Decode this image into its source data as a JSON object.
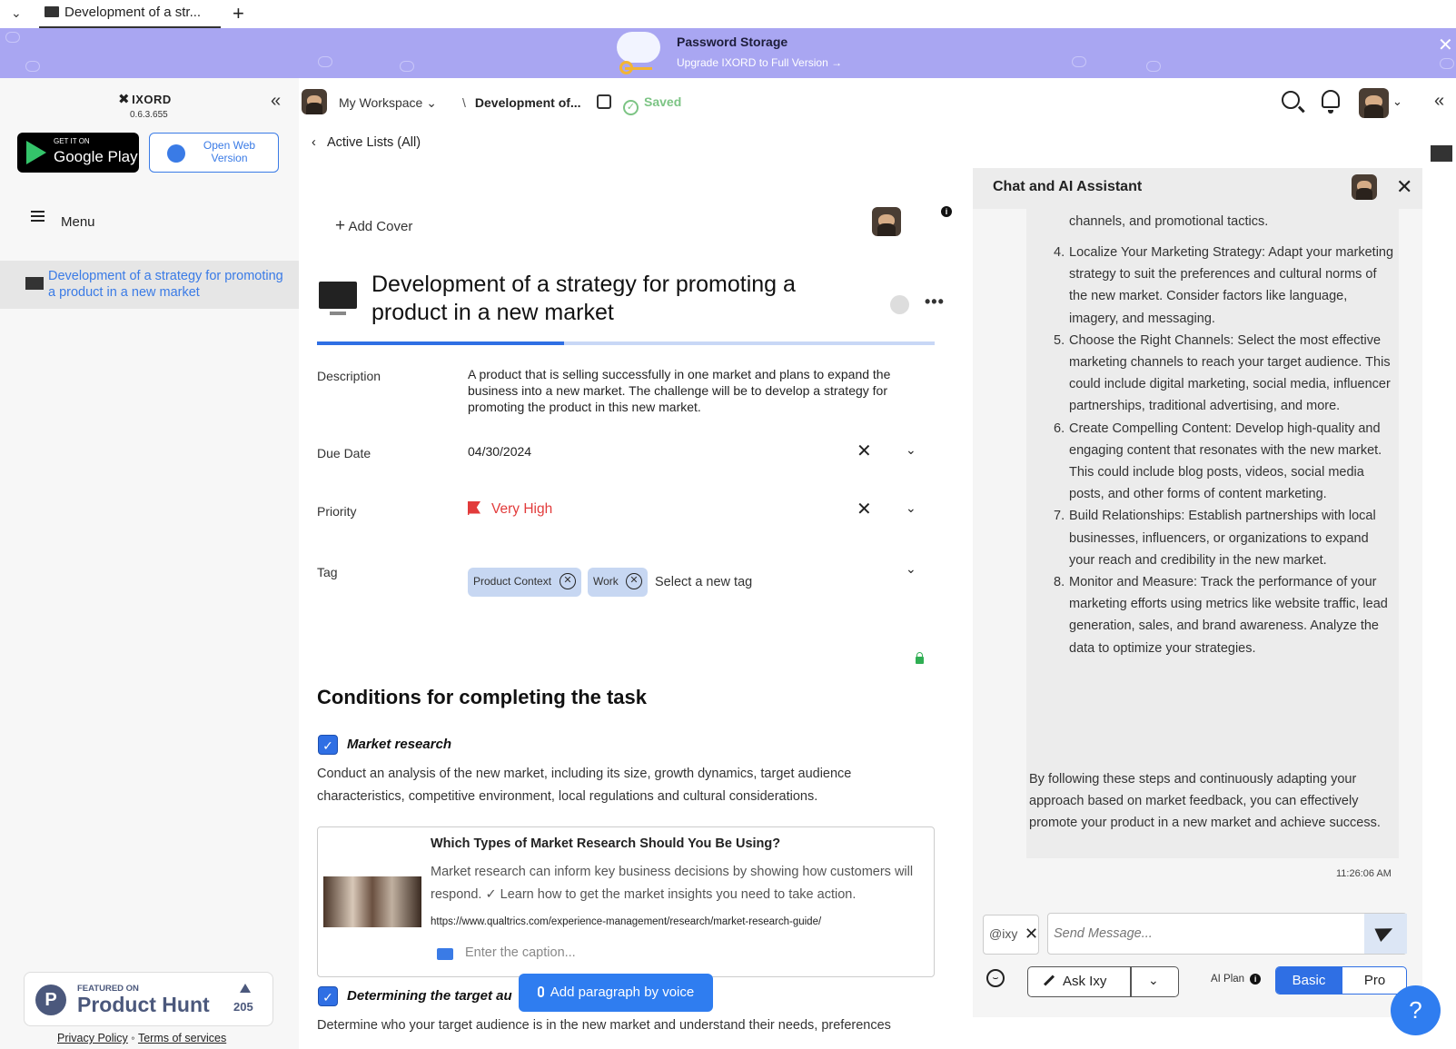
{
  "tabbar": {
    "tab_title": "Development of a str...",
    "new_tab": "+"
  },
  "banner": {
    "title": "Password Storage",
    "subtitle": "Upgrade IXORD to Full Version →",
    "close": "✕"
  },
  "sidebar": {
    "brand": "IXORD",
    "version": "0.6.3.655",
    "collapse": "«",
    "google_play_small": "GET IT ON",
    "google_play_big": "Google Play",
    "open_web_line1": "Open Web",
    "open_web_line2": "Version",
    "menu_label": "Menu",
    "active_item": "Development of a strategy for promoting a product in a new market",
    "product_hunt": {
      "featured": "FEATURED ON",
      "name": "Product Hunt",
      "count": "205"
    },
    "privacy": "Privacy Policy",
    "terms": "Terms of services"
  },
  "header": {
    "workspace": "My Workspace",
    "breadcrumb": "Development of...",
    "saved": "Saved",
    "back": "Active Lists (All)"
  },
  "task": {
    "add_cover": "Add Cover",
    "title": "Development of a strategy for promoting a product in a new market",
    "progress_fraction": 0.4,
    "fields": {
      "description_label": "Description",
      "description": "A product that is selling successfully in one market and plans to expand the business into a new market. The challenge will be to develop a strategy for promoting the product in this new market.",
      "due_label": "Due Date",
      "due_value": "04/30/2024",
      "priority_label": "Priority",
      "priority_value": "Very High",
      "tag_label": "Tag",
      "tags": [
        "Product Context",
        "Work"
      ],
      "tag_placeholder": "Select a new tag"
    },
    "conditions_heading": "Conditions for completing the task",
    "condition1_title": "Market research",
    "condition1_text": "Conduct an analysis of the new market, including its size, growth dynamics, target audience characteristics, competitive environment, local regulations and cultural considerations.",
    "link_card": {
      "title": "Which Types of Market Research Should You Be Using?",
      "description": "Market research can inform key business decisions by showing how customers will respond. ✓ Learn how to get the market insights you need to take action.",
      "url": "https://www.qualtrics.com/experience-management/research/market-research-guide/",
      "caption_placeholder": "Enter the caption..."
    },
    "condition2_title": "Determining the target au",
    "condition2_text": "Determine who your target audience is in the new market and understand their needs, preferences",
    "voice_button": "Add paragraph by voice"
  },
  "chat": {
    "title": "Chat and AI Assistant",
    "partial_line": "channels, and promotional tactics.",
    "steps": [
      {
        "n": "4.",
        "text": "Localize Your Marketing Strategy: Adapt your marketing strategy to suit the preferences and cultural norms of the new market. Consider factors like language, imagery, and messaging."
      },
      {
        "n": "5.",
        "text": "Choose the Right Channels: Select the most effective marketing channels to reach your target audience. This could include digital marketing, social media, influencer partnerships, traditional advertising, and more."
      },
      {
        "n": "6.",
        "text": "Create Compelling Content: Develop high-quality and engaging content that resonates with the new market. This could include blog posts, videos, social media posts, and other forms of content marketing."
      },
      {
        "n": "7.",
        "text": "Build Relationships: Establish partnerships with local businesses, influencers, or organizations to expand your reach and credibility in the new market."
      },
      {
        "n": "8.",
        "text": "Monitor and Measure: Track the performance of your marketing efforts using metrics like website traffic, lead generation, sales, and brand awareness. Analyze the data to optimize your strategies."
      }
    ],
    "closing": "By following these steps and continuously adapting your approach based on market feedback, you can effectively promote your product in a new market and achieve success.",
    "timestamp": "11:26:06 AM",
    "mention": "@ixy",
    "send_placeholder": "Send Message...",
    "ask_button": "Ask Ixy",
    "ai_plan_label": "AI Plan",
    "plan_basic": "Basic",
    "plan_pro": "Pro",
    "help": "?"
  },
  "colors": {
    "accent": "#2f6fe4",
    "banner": "#a9a6f2",
    "priority": "#e23b3b",
    "saved": "#7cc484"
  }
}
